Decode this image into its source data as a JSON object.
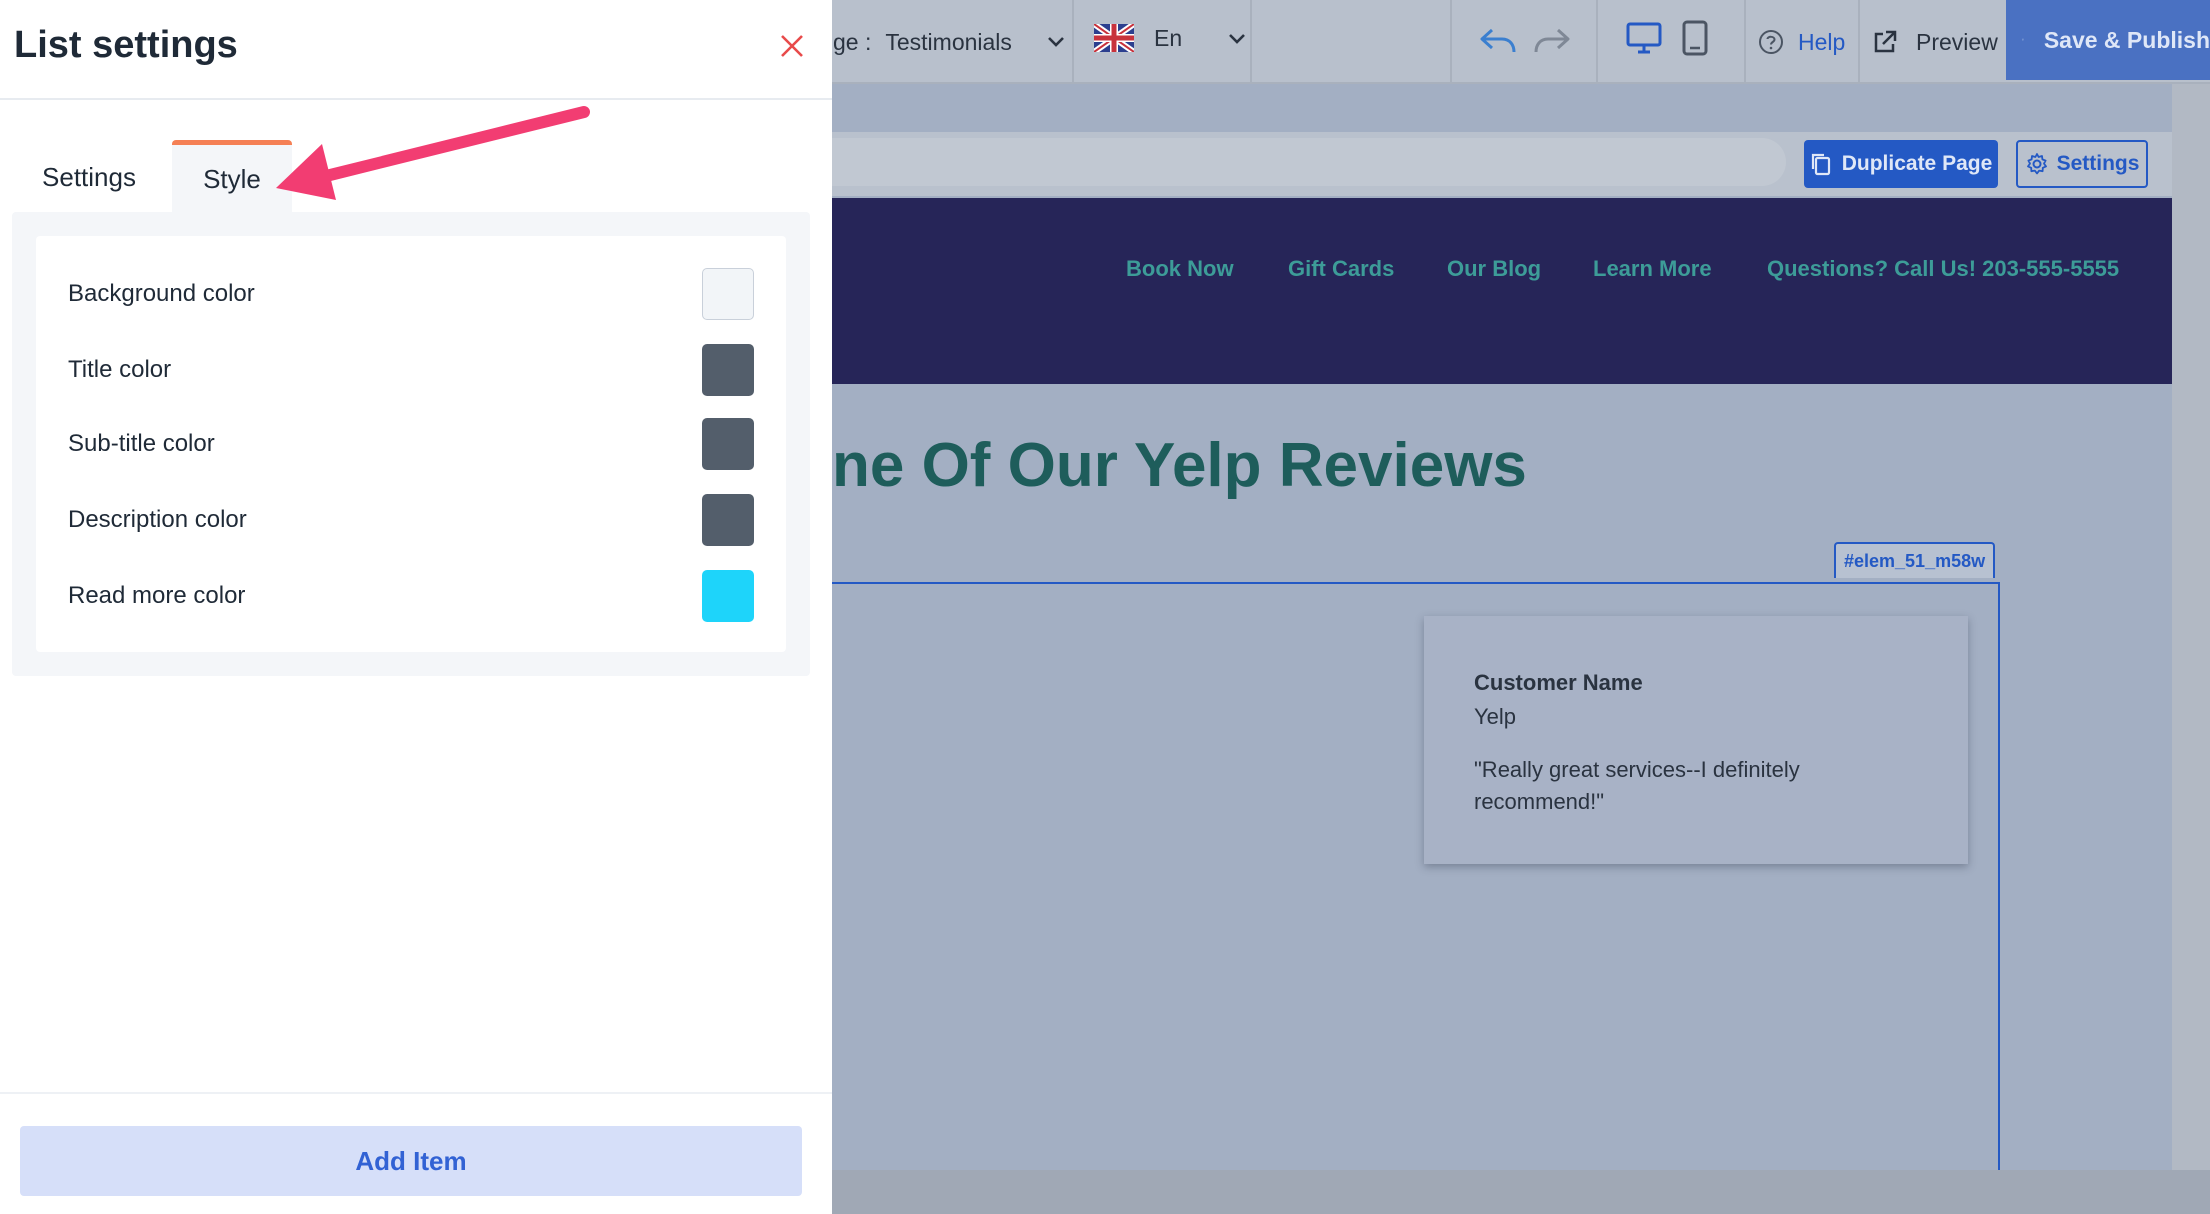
{
  "toolbar": {
    "page_label": "ge :",
    "page_value": "Testimonials",
    "language": "En",
    "help": "Help",
    "preview": "Preview",
    "save_publish": "Save & Publish"
  },
  "canvas": {
    "duplicate_page": "Duplicate Page",
    "settings": "Settings",
    "nav_links": [
      "Book Now",
      "Gift Cards",
      "Our Blog",
      "Learn More",
      "Questions? Call Us! 203-555-5555"
    ],
    "heading": "ne Of Our Yelp Reviews",
    "element_id": "#elem_51_m58w",
    "review": {
      "name": "Customer Name",
      "source": "Yelp",
      "quote": "\"Really great services--I definitely recommend!\""
    }
  },
  "panel": {
    "title": "List settings",
    "tabs": {
      "settings": "Settings",
      "style": "Style"
    },
    "active_tab": "Style",
    "colors": [
      {
        "label": "Background color",
        "color": "#f2f5f8"
      },
      {
        "label": "Title color",
        "color": "#535e6b"
      },
      {
        "label": "Sub-title color",
        "color": "#535e6b"
      },
      {
        "label": "Description color",
        "color": "#535e6b"
      },
      {
        "label": "Read more color",
        "color": "#1ed4fa"
      }
    ],
    "add_item": "Add Item"
  },
  "colors": {
    "accent_blue": "#2459c4",
    "tab_active_orange": "#f58055",
    "annotation_arrow": "#f23d72",
    "close_red": "#e84a4a"
  }
}
